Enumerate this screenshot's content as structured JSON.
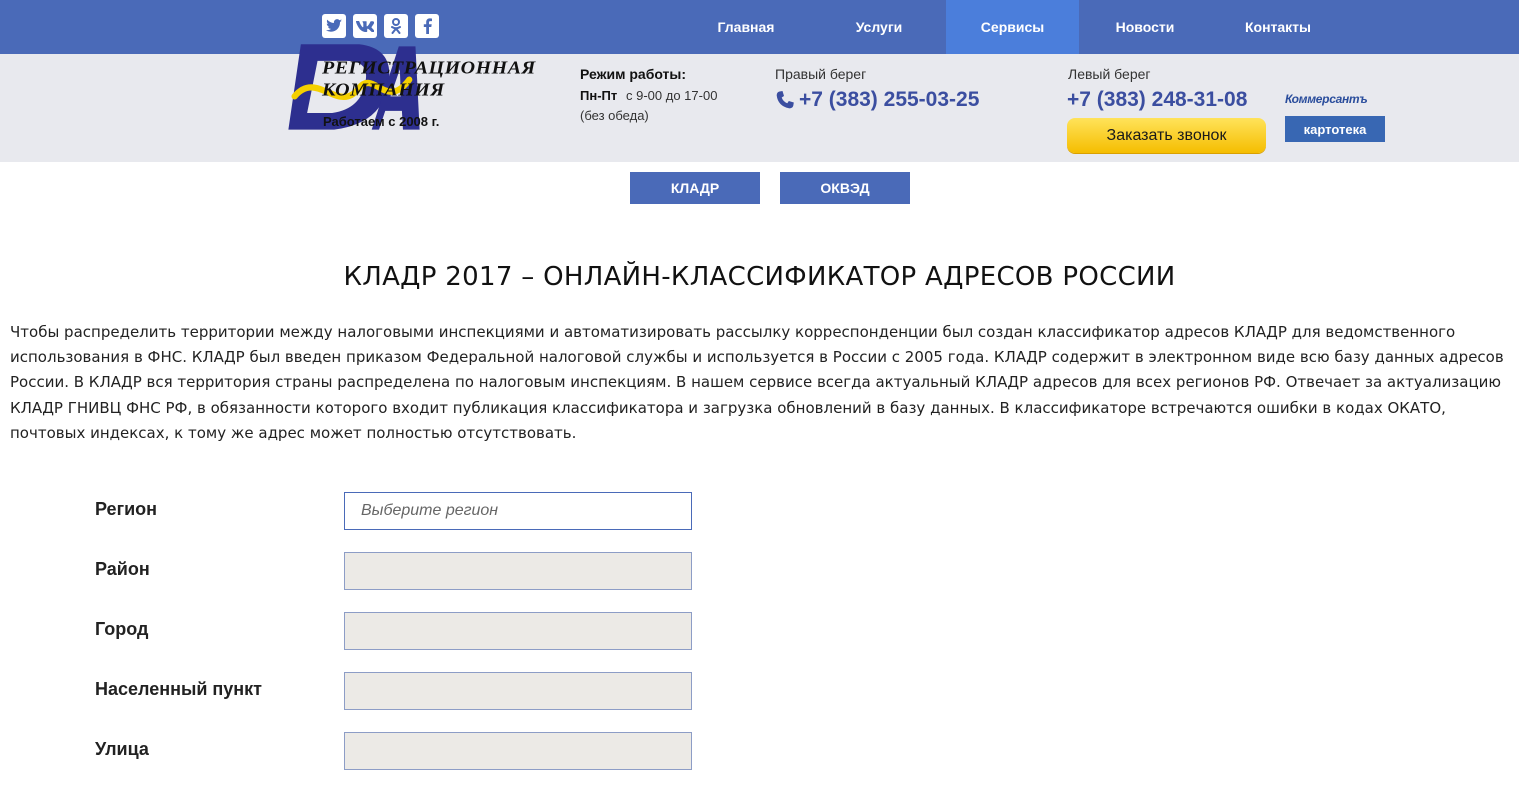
{
  "nav": {
    "items": [
      {
        "label": "Главная"
      },
      {
        "label": "Услуги"
      },
      {
        "label": "Сервисы",
        "active": true
      },
      {
        "label": "Новости"
      },
      {
        "label": "Контакты"
      }
    ],
    "active_color": "#4b7edb",
    "bar_color": "#4a6ab8"
  },
  "socials": [
    "twitter-icon",
    "vk-icon",
    "odnoklassniki-icon",
    "facebook-icon"
  ],
  "brand": {
    "line1": "РЕГИСТРАЦИОННАЯ",
    "line2": "КОМПАНИЯ",
    "since": "Работаем с 2008 г.",
    "logo": "ДА"
  },
  "hours": {
    "title": "Режим работы:",
    "days": "Пн-Пт",
    "time": "с 9-00 до 17-00",
    "note": "(без обеда)"
  },
  "contacts": {
    "right_label": "Правый берег",
    "right_phone": "+7 (383) 255-03-25",
    "left_label": "Левый берег",
    "left_phone": "+7 (383) 248-31-08",
    "callback_label": "Заказать звонок"
  },
  "partner": {
    "line1": "Коммерсантъ",
    "line2": "картотека"
  },
  "tabs": {
    "kladr": "КЛАДР",
    "okved": "ОКВЭД"
  },
  "page": {
    "title": "КЛАДР 2017 – ОНЛАЙН-КЛАССИФИКАТОР АДРЕСОВ РОССИИ",
    "description": "Чтобы распределить территории между налоговыми инспекциями и автоматизировать рассылку корреспонденции был создан классификатор адресов КЛАДР для ведомственного использования в ФНС. КЛАДР был введен приказом Федеральной налоговой службы и используется в России с 2005 года. КЛАДР содержит в электронном виде всю базу данных адресов России. В КЛАДР вся территория страны распределена по налоговым инспекциям. В нашем сервисе всегда актуальный КЛАДР адресов для всех регионов РФ. Отвечает за актуализацию КЛАДР ГНИВЦ ФНС РФ, в обязанности которого входит публикация классификатора и загрузка обновлений в базу данных. В классификаторе встречаются ошибки в кодах ОКАТО, почтовых индексах, к тому же адрес может полностью отсутствовать."
  },
  "form": {
    "fields": [
      {
        "label": "Регион",
        "placeholder": "Выберите регион",
        "enabled": true
      },
      {
        "label": "Район",
        "placeholder": "",
        "enabled": false
      },
      {
        "label": "Город",
        "placeholder": "",
        "enabled": false
      },
      {
        "label": "Населенный пункт",
        "placeholder": "",
        "enabled": false
      },
      {
        "label": "Улица",
        "placeholder": "",
        "enabled": false
      }
    ]
  }
}
